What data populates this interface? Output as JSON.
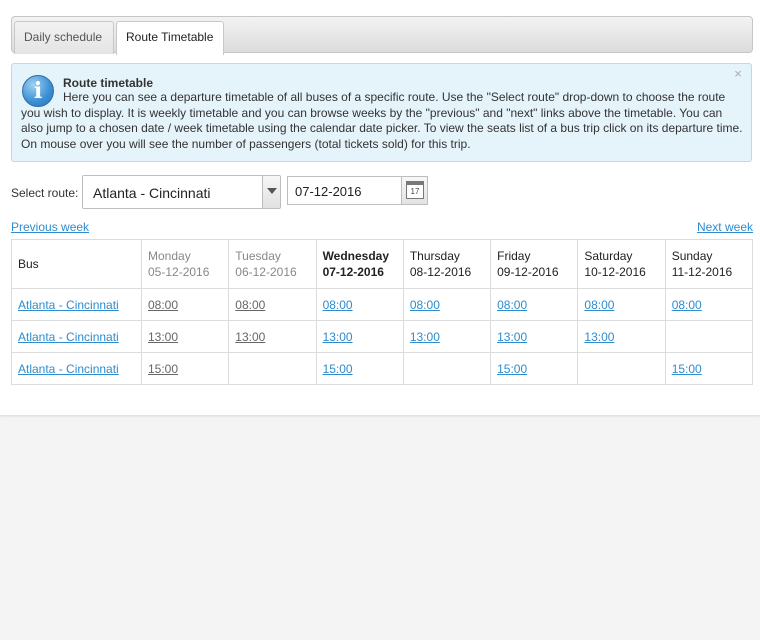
{
  "tabs": [
    {
      "label": "Daily schedule",
      "active": false
    },
    {
      "label": "Route Timetable",
      "active": true
    }
  ],
  "info": {
    "title": "Route timetable",
    "text": "Here you can see a departure timetable of all buses of a specific route. Use the \"Select route\" drop-down to choose the route you wish to display. It is weekly timetable and you can browse weeks by the \"previous\" and \"next\" links above the timetable. You can also jump to a chosen date / week timetable using the calendar date picker. To view the seats list of a bus trip click on its departure time. On mouse over you will see the number of passengers (total tickets sold) for this trip.",
    "close": "×"
  },
  "filter": {
    "route_label": "Select route:",
    "route_value": "Atlanta - Cincinnati",
    "date_value": "07-12-2016",
    "calendar_glyph": "17"
  },
  "nav": {
    "prev": "Previous week",
    "next": "Next week"
  },
  "table": {
    "bus_header": "Bus",
    "days": [
      {
        "name": "Monday",
        "date": "05-12-2016",
        "state": "past"
      },
      {
        "name": "Tuesday",
        "date": "06-12-2016",
        "state": "past"
      },
      {
        "name": "Wednesday",
        "date": "07-12-2016",
        "state": "today"
      },
      {
        "name": "Thursday",
        "date": "08-12-2016",
        "state": "future"
      },
      {
        "name": "Friday",
        "date": "09-12-2016",
        "state": "future"
      },
      {
        "name": "Saturday",
        "date": "10-12-2016",
        "state": "future"
      },
      {
        "name": "Sunday",
        "date": "11-12-2016",
        "state": "future"
      }
    ],
    "rows": [
      {
        "bus": "Atlanta - Cincinnati",
        "times": [
          "08:00",
          "08:00",
          "08:00",
          "08:00",
          "08:00",
          "08:00",
          "08:00"
        ]
      },
      {
        "bus": "Atlanta - Cincinnati",
        "times": [
          "13:00",
          "13:00",
          "13:00",
          "13:00",
          "13:00",
          "13:00",
          ""
        ]
      },
      {
        "bus": "Atlanta - Cincinnati",
        "times": [
          "15:00",
          "",
          "15:00",
          "",
          "15:00",
          "",
          "15:00"
        ]
      }
    ]
  },
  "colors": {
    "link": "#2e8ccf",
    "info_bg": "#e5f3fa",
    "info_border": "#b9dceb"
  }
}
